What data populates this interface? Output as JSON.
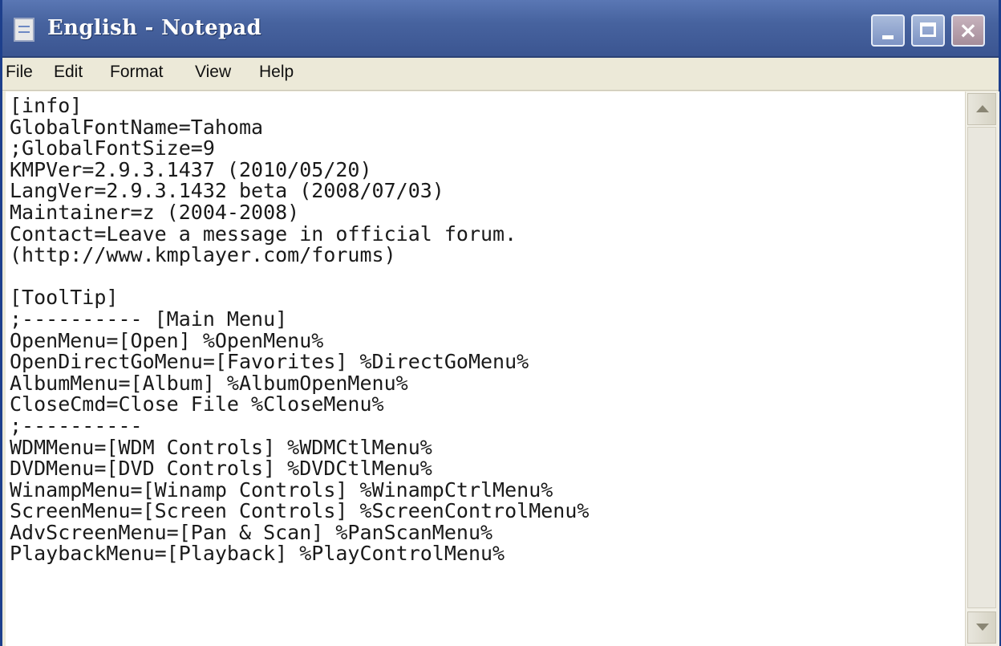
{
  "window": {
    "title": "English - Notepad",
    "icon": "notepad-icon"
  },
  "controls": {
    "minimize": "minimize-icon",
    "maximize": "maximize-icon",
    "close": "close-icon",
    "close_glyph": "×"
  },
  "menu": {
    "items": [
      {
        "label": "File"
      },
      {
        "label": "Edit"
      },
      {
        "label": "Format"
      },
      {
        "label": "View"
      },
      {
        "label": "Help"
      }
    ]
  },
  "editor": {
    "lines": [
      "[info]",
      "GlobalFontName=Tahoma",
      ";GlobalFontSize=9",
      "KMPVer=2.9.3.1437 (2010/05/20)",
      "LangVer=2.9.3.1432 beta (2008/07/03)",
      "Maintainer=z (2004-2008)",
      "Contact=Leave a message in official forum.",
      "(http://www.kmplayer.com/forums)",
      "",
      "[ToolTip]",
      ";---------- [Main Menu]",
      "OpenMenu=[Open] %OpenMenu%",
      "OpenDirectGoMenu=[Favorites] %DirectGoMenu%",
      "AlbumMenu=[Album] %AlbumOpenMenu%",
      "CloseCmd=Close File %CloseMenu%",
      ";----------",
      "WDMMenu=[WDM Controls] %WDMCtlMenu%",
      "DVDMenu=[DVD Controls] %DVDCtlMenu%",
      "WinampMenu=[Winamp Controls] %WinampCtrlMenu%",
      "ScreenMenu=[Screen Controls] %ScreenControlMenu%",
      "AdvScreenMenu=[Pan & Scan] %PanScanMenu%",
      "PlaybackMenu=[Playback] %PlayControlMenu%"
    ]
  },
  "scrollbar": {
    "up": "scroll-up-arrow-icon",
    "down": "scroll-down-arrow-icon"
  }
}
